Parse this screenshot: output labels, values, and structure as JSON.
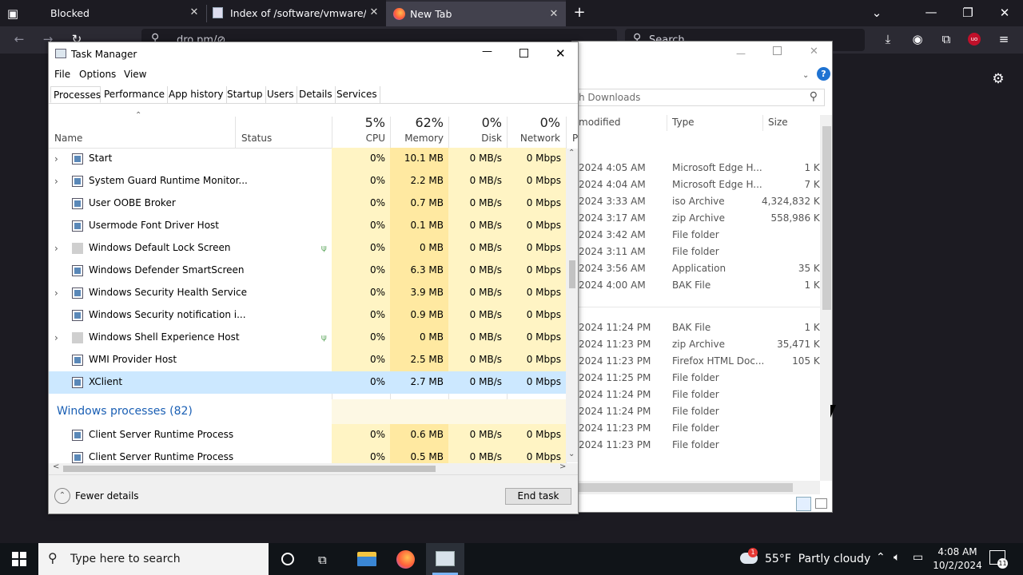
{
  "browser": {
    "tabs": [
      {
        "title": "Blocked"
      },
      {
        "title": "Index of /software/vmware/wor"
      },
      {
        "title": "New Tab"
      }
    ],
    "url_text": "dro.pm/⊘",
    "search_placeholder": "Search"
  },
  "explorer": {
    "search_placeholder": "h Downloads",
    "columns": {
      "modified": "modified",
      "type": "Type",
      "size": "Size"
    },
    "rows": [
      {
        "modified": "2024 4:05 AM",
        "type": "Microsoft Edge H...",
        "size": "1 KB"
      },
      {
        "modified": "2024 4:04 AM",
        "type": "Microsoft Edge H...",
        "size": "7 KB"
      },
      {
        "modified": "2024 3:33 AM",
        "type": "iso Archive",
        "size": "4,324,832 KB"
      },
      {
        "modified": "2024 3:17 AM",
        "type": "zip Archive",
        "size": "558,986 KB"
      },
      {
        "modified": "2024 3:42 AM",
        "type": "File folder",
        "size": ""
      },
      {
        "modified": "2024 3:11 AM",
        "type": "File folder",
        "size": ""
      },
      {
        "modified": "2024 3:56 AM",
        "type": "Application",
        "size": "35 KB"
      },
      {
        "modified": "2024 4:00 AM",
        "type": "BAK File",
        "size": "1 KB"
      },
      {
        "modified": "2024 11:24 PM",
        "type": "BAK File",
        "size": "1 KB"
      },
      {
        "modified": "2024 11:23 PM",
        "type": "zip Archive",
        "size": "35,471 KB"
      },
      {
        "modified": "2024 11:23 PM",
        "type": "Firefox HTML Doc...",
        "size": "105 KB"
      },
      {
        "modified": "2024 11:25 PM",
        "type": "File folder",
        "size": ""
      },
      {
        "modified": "2024 11:24 PM",
        "type": "File folder",
        "size": ""
      },
      {
        "modified": "2024 11:24 PM",
        "type": "File folder",
        "size": ""
      },
      {
        "modified": "2024 11:23 PM",
        "type": "File folder",
        "size": ""
      },
      {
        "modified": "2024 11:23 PM",
        "type": "File folder",
        "size": ""
      }
    ]
  },
  "taskmanager": {
    "title": "Task Manager",
    "menu": [
      "File",
      "Options",
      "View"
    ],
    "tabs": [
      "Processes",
      "Performance",
      "App history",
      "Startup",
      "Users",
      "Details",
      "Services"
    ],
    "columns": {
      "name": "Name",
      "status": "Status",
      "cpu_pct": "5%",
      "cpu": "CPU",
      "mem_pct": "62%",
      "mem": "Memory",
      "disk_pct": "0%",
      "disk": "Disk",
      "net_pct": "0%",
      "net": "Network",
      "power": "P"
    },
    "processes": [
      {
        "name": "Start",
        "expand": true,
        "cpu": "0%",
        "mem": "10.1 MB",
        "disk": "0 MB/s",
        "net": "0 Mbps"
      },
      {
        "name": "System Guard Runtime Monitor...",
        "expand": true,
        "cpu": "0%",
        "mem": "2.2 MB",
        "disk": "0 MB/s",
        "net": "0 Mbps"
      },
      {
        "name": "User OOBE Broker",
        "expand": false,
        "cpu": "0%",
        "mem": "0.7 MB",
        "disk": "0 MB/s",
        "net": "0 Mbps"
      },
      {
        "name": "Usermode Font Driver Host",
        "expand": false,
        "cpu": "0%",
        "mem": "0.1 MB",
        "disk": "0 MB/s",
        "net": "0 Mbps"
      },
      {
        "name": "Windows Default Lock Screen",
        "expand": true,
        "suspended": true,
        "cpu": "0%",
        "mem": "0 MB",
        "disk": "0 MB/s",
        "net": "0 Mbps"
      },
      {
        "name": "Windows Defender SmartScreen",
        "expand": false,
        "cpu": "0%",
        "mem": "6.3 MB",
        "disk": "0 MB/s",
        "net": "0 Mbps"
      },
      {
        "name": "Windows Security Health Service",
        "expand": true,
        "cpu": "0%",
        "mem": "3.9 MB",
        "disk": "0 MB/s",
        "net": "0 Mbps"
      },
      {
        "name": "Windows Security notification i...",
        "expand": false,
        "cpu": "0%",
        "mem": "0.9 MB",
        "disk": "0 MB/s",
        "net": "0 Mbps"
      },
      {
        "name": "Windows Shell Experience Host",
        "expand": true,
        "suspended": true,
        "cpu": "0%",
        "mem": "0 MB",
        "disk": "0 MB/s",
        "net": "0 Mbps"
      },
      {
        "name": "WMI Provider Host",
        "expand": false,
        "cpu": "0%",
        "mem": "2.5 MB",
        "disk": "0 MB/s",
        "net": "0 Mbps"
      },
      {
        "name": "XClient",
        "expand": false,
        "selected": true,
        "cpu": "0%",
        "mem": "2.7 MB",
        "disk": "0 MB/s",
        "net": "0 Mbps"
      }
    ],
    "group_label": "Windows processes (82)",
    "windows_processes": [
      {
        "name": "Client Server Runtime Process",
        "cpu": "0%",
        "mem": "0.6 MB",
        "disk": "0 MB/s",
        "net": "0 Mbps"
      },
      {
        "name": "Client Server Runtime Process",
        "cpu": "0%",
        "mem": "0.5 MB",
        "disk": "0 MB/s",
        "net": "0 Mbps"
      }
    ],
    "fewer_details": "Fewer details",
    "end_task": "End task"
  },
  "taskbar": {
    "search_placeholder": "Type here to search",
    "weather": "55°F  Partly cloudy",
    "time": "4:08 AM",
    "date": "10/2/2024",
    "notif_count": "11",
    "weather_badge": "1"
  },
  "colors": {
    "accent": "#0067c0",
    "selected_row": "#cce8ff",
    "heat_light": "#fff4c4",
    "heat_mem": "#ffe9a1"
  }
}
